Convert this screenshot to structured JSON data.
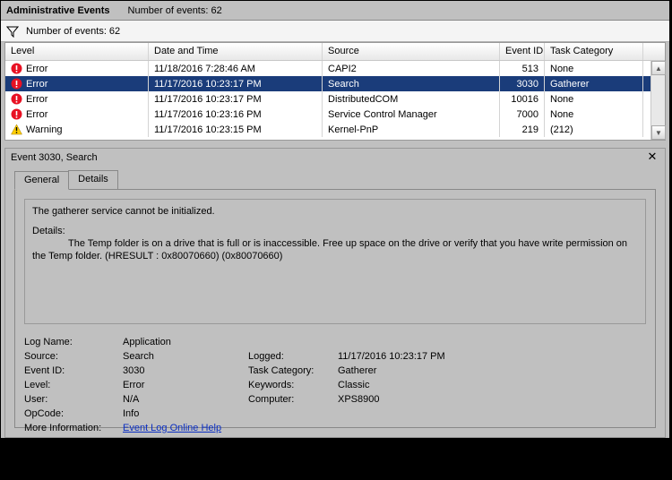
{
  "header": {
    "title": "Administrative Events",
    "count_label": "Number of events: 62"
  },
  "filter": {
    "count_label": "Number of events: 62"
  },
  "grid": {
    "columns": {
      "level": "Level",
      "datetime": "Date and Time",
      "source": "Source",
      "event_id": "Event ID",
      "task_category": "Task Category"
    },
    "rows": [
      {
        "icon": "error",
        "level": "Error",
        "dt": "11/18/2016 7:28:46 AM",
        "src": "CAPI2",
        "id": "513",
        "tc": "None",
        "selected": false
      },
      {
        "icon": "error",
        "level": "Error",
        "dt": "11/17/2016 10:23:17 PM",
        "src": "Search",
        "id": "3030",
        "tc": "Gatherer",
        "selected": true
      },
      {
        "icon": "error",
        "level": "Error",
        "dt": "11/17/2016 10:23:17 PM",
        "src": "DistributedCOM",
        "id": "10016",
        "tc": "None",
        "selected": false
      },
      {
        "icon": "error",
        "level": "Error",
        "dt": "11/17/2016 10:23:16 PM",
        "src": "Service Control Manager",
        "id": "7000",
        "tc": "None",
        "selected": false
      },
      {
        "icon": "warn",
        "level": "Warning",
        "dt": "11/17/2016 10:23:15 PM",
        "src": "Kernel-PnP",
        "id": "219",
        "tc": "(212)",
        "selected": false
      }
    ]
  },
  "details": {
    "title": "Event 3030, Search",
    "tabs": {
      "general": "General",
      "details": "Details"
    },
    "message": {
      "line1": "The gatherer service cannot be initialized.",
      "line2": "Details:",
      "line3": "The Temp folder is on a drive that is full or is inaccessible. Free up space on the drive or verify that you have write permission on the Temp folder. (HRESULT : 0x80070660) (0x80070660)"
    },
    "kv": {
      "log_name_k": "Log Name:",
      "log_name_v": "Application",
      "source_k": "Source:",
      "source_v": "Search",
      "logged_k": "Logged:",
      "logged_v": "11/17/2016 10:23:17 PM",
      "event_id_k": "Event ID:",
      "event_id_v": "3030",
      "task_cat_k": "Task Category:",
      "task_cat_v": "Gatherer",
      "level_k": "Level:",
      "level_v": "Error",
      "keywords_k": "Keywords:",
      "keywords_v": "Classic",
      "user_k": "User:",
      "user_v": "N/A",
      "computer_k": "Computer:",
      "computer_v": "XPS8900",
      "opcode_k": "OpCode:",
      "opcode_v": "Info",
      "more_k": "More Information:",
      "more_link": "Event Log Online Help"
    }
  }
}
